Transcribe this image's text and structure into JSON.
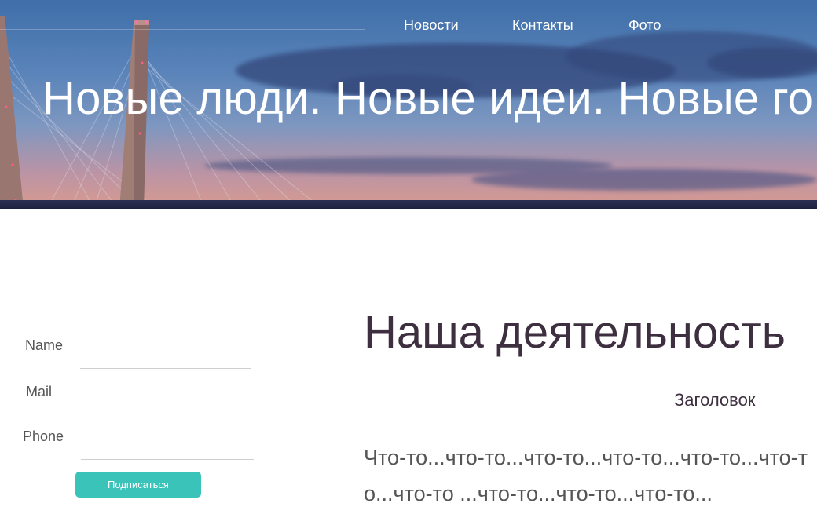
{
  "nav": {
    "items": [
      {
        "label": "Новости"
      },
      {
        "label": "Контакты"
      },
      {
        "label": "Фото"
      }
    ]
  },
  "hero": {
    "headline": "Новые люди. Новые идеи. Новые го"
  },
  "form": {
    "name_label": "Name",
    "mail_label": "Mail",
    "phone_label": "Phone",
    "name_value": "",
    "mail_value": "",
    "phone_value": "",
    "submit_label": "Подписаться",
    "accent_color": "#3ac3b8"
  },
  "main": {
    "title": "Наша деятельность",
    "subheading": "Заголовок",
    "body": "Что-то...что-то...что-то...что-то...что-то...что-то...что-то ...что-то...что-то...что-то..."
  }
}
